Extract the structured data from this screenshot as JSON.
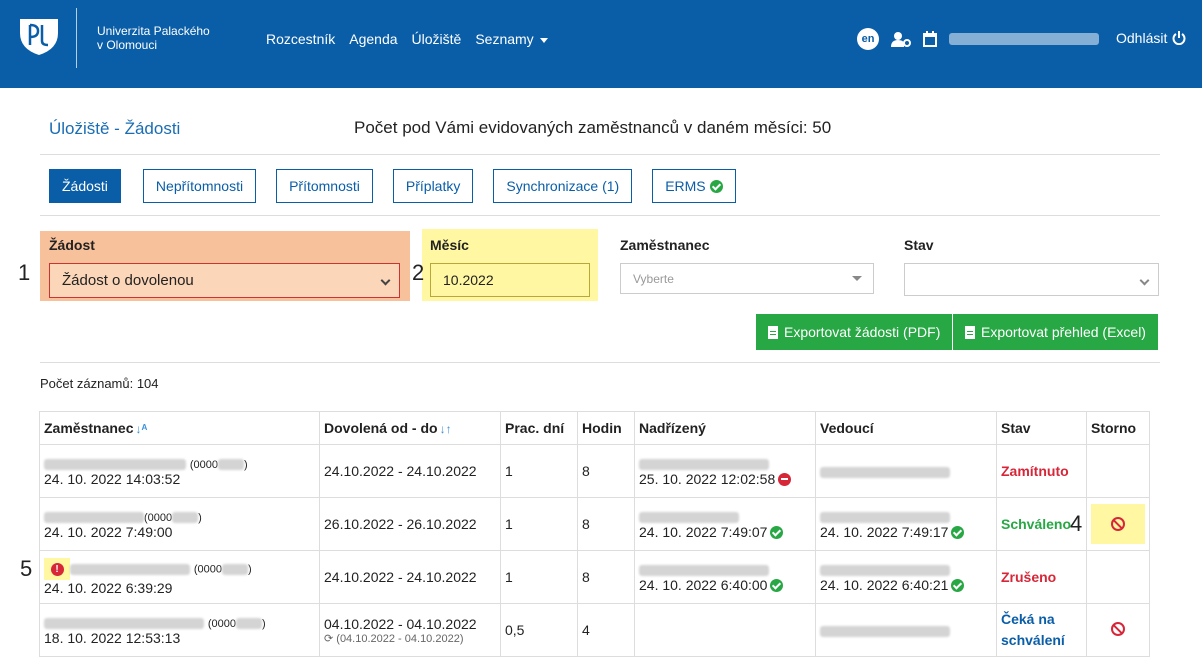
{
  "header": {
    "university_line1": "Univerzita Palackého",
    "university_line2": "v Olomouci",
    "nav": [
      "Rozcestník",
      "Agenda",
      "Úložiště",
      "Seznamy"
    ],
    "lang": "en",
    "logout": "Odhlásit"
  },
  "page": {
    "breadcrumb": "Úložiště - Žádosti",
    "employee_count_text": "Počet pod Vámi evidovaných zaměstnanců v daném měsíci: 50",
    "records_count": "Počet záznamů: 104"
  },
  "tabs": [
    "Žádosti",
    "Nepřítomnosti",
    "Přítomnosti",
    "Příplatky",
    "Synchronizace (1)",
    "ERMS"
  ],
  "filters": {
    "request": {
      "label": "Žádost",
      "value": "Žádost o dovolenou"
    },
    "month": {
      "label": "Měsíc",
      "value": "10.2022"
    },
    "employee": {
      "label": "Zaměstnanec",
      "placeholder": "Vyberte"
    },
    "state": {
      "label": "Stav",
      "value": ""
    }
  },
  "buttons": {
    "export_pdf": "Exportovat žádosti (PDF)",
    "export_excel": "Exportovat přehled (Excel)"
  },
  "callouts": [
    "1",
    "2",
    "4",
    "5"
  ],
  "table": {
    "headers": [
      "Zaměstnanec",
      "Dovolená od - do",
      "Prac. dní",
      "Hodin",
      "Nadřízený",
      "Vedoucí",
      "Stav",
      "Storno"
    ],
    "rows": [
      {
        "emp_id": "(0000",
        "emp_time": "24. 10. 2022 14:03:52",
        "range": "24.10.2022 - 24.10.2022",
        "days": "1",
        "hours": "8",
        "sup_time": "25. 10. 2022 12:02:58",
        "head_time": "",
        "state": "Zamítnuto"
      },
      {
        "emp_id": "(0000",
        "emp_time": "24. 10. 2022 7:49:00",
        "range": "26.10.2022 - 26.10.2022",
        "days": "1",
        "hours": "8",
        "sup_time": "24. 10. 2022 7:49:07",
        "head_time": "24. 10. 2022 7:49:17",
        "state": "Schváleno"
      },
      {
        "emp_id": "(0000",
        "emp_time": "24. 10. 2022 6:39:29",
        "range": "24.10.2022 - 24.10.2022",
        "days": "1",
        "hours": "8",
        "sup_time": "24. 10. 2022 6:40:00",
        "head_time": "24. 10. 2022 6:40:21",
        "state": "Zrušeno"
      },
      {
        "emp_id": "(0000",
        "emp_time": "18. 10. 2022 12:53:13",
        "range": "04.10.2022 - 04.10.2022",
        "sync_range": "(04.10.2022 - 04.10.2022)",
        "days": "0,5",
        "hours": "4",
        "sup_time": "",
        "head_time": "",
        "state_line1": "Čeká na",
        "state_line2": "schválení"
      }
    ]
  },
  "colors": {
    "header_bg": "#0a5ea8",
    "highlight_orange": "#f7c19b",
    "highlight_yellow": "#fff7a1",
    "green": "#28a745",
    "red": "#d72638"
  }
}
